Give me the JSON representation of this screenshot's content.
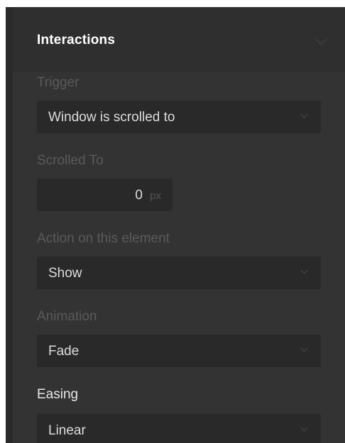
{
  "header": {
    "title": "Interactions"
  },
  "trigger": {
    "label": "Trigger",
    "value": "Window is scrolled to"
  },
  "scrolled_to": {
    "label": "Scrolled To",
    "value": "0",
    "unit": "px"
  },
  "action": {
    "label": "Action on this element",
    "value": "Show"
  },
  "animation": {
    "label": "Animation",
    "value": "Fade"
  },
  "easing": {
    "label": "Easing",
    "value": "Linear"
  },
  "icons": {
    "collapse": "chevron-down-icon",
    "dropdown": "chevron-down-icon"
  }
}
